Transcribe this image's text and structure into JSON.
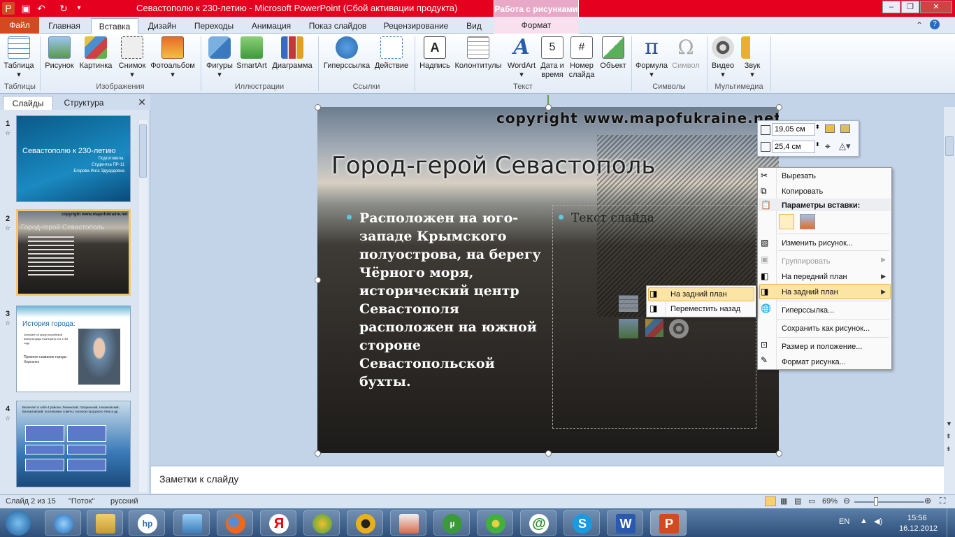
{
  "window": {
    "title": "Севастополю к 230-летию  -  Microsoft PowerPoint (Сбой активации продукта)",
    "context_tab_title": "Работа с рисунками"
  },
  "tabs": [
    "Файл",
    "Главная",
    "Вставка",
    "Дизайн",
    "Переходы",
    "Анимация",
    "Показ слайдов",
    "Рецензирование",
    "Вид",
    "Формат"
  ],
  "ribbon": {
    "groups": [
      "Таблицы",
      "Изображения",
      "Иллюстрации",
      "Ссылки",
      "Текст",
      "Символы",
      "Мультимедиа"
    ],
    "buttons": {
      "table": "Таблица",
      "picture": "Рисунок",
      "clipart": "Картинка",
      "screenshot": "Снимок",
      "photoalbum": "Фотоальбом",
      "shapes": "Фигуры",
      "smartart": "SmartArt",
      "chart": "Диаграмма",
      "hyperlink": "Гиперссылка",
      "action": "Действие",
      "textbox": "Надпись",
      "headerfooter": "Колонтитулы",
      "wordart": "WordArt",
      "datetime_1": "Дата и",
      "datetime_2": "время",
      "slidenum_1": "Номер",
      "slidenum_2": "слайда",
      "object": "Объект",
      "equation": "Формула",
      "symbol": "Символ",
      "video": "Видео",
      "audio": "Звук"
    }
  },
  "panel": {
    "tab_slides": "Слайды",
    "tab_outline": "Структура",
    "close": "✕",
    "thumbs": [
      {
        "num": "1",
        "title": "Севастополю к 230-летию",
        "sub1": "Подготовила:",
        "sub2": "Студентка ПР-11",
        "sub3": "Егорова Инга Эдуардовна"
      },
      {
        "num": "2",
        "title": "Город-герой Севастополь",
        "copyright": "copyright www.mapofukraine.net"
      },
      {
        "num": "3",
        "title": "История города:",
        "b1": "Заложен по указу российской императрицы Екатерины II в 1783 году.",
        "b2": "Прежнее название города - Херсонес"
      },
      {
        "num": "4",
        "b1": "Включает в себя 4 района: Ленинский, Гагаринский, Нахимовский, Балаклавский, поселковые советы; поселок городского типа и др."
      }
    ]
  },
  "slide": {
    "copyright": "copyright www.mapofukraine.net",
    "title": "Город-герой Севастополь",
    "body": "Расположен на юго-западе Крымского полуострова, на берегу Чёрного моря, исторический центр Севастополя расположен на южной стороне Севастопольской бухты.",
    "placeholder_text": "Текст слайда"
  },
  "mini_toolbar": {
    "height_value": "19,05 см",
    "width_value": "25,4 см"
  },
  "context_menu": {
    "cut": "Вырезать",
    "copy": "Копировать",
    "paste_options": "Параметры вставки:",
    "change_picture": "Изменить рисунок...",
    "group": "Группировать",
    "bring_front": "На передний план",
    "send_back": "На задний план",
    "hyperlink": "Гиперссылка...",
    "save_as_picture": "Сохранить как рисунок...",
    "size_position": "Размер и положение...",
    "format_picture": "Формат рисунка..."
  },
  "submenu": {
    "send_to_back": "На задний план",
    "send_backward": "Переместить назад"
  },
  "notes": {
    "placeholder": "Заметки к слайду"
  },
  "status": {
    "slide_of": "Слайд 2 из 15",
    "theme": "\"Поток\"",
    "language": "русский",
    "zoom": "69%"
  },
  "taskbar": {
    "lang": "EN",
    "time": "15:56",
    "date": "16.12.2012"
  },
  "colors": {
    "titlebar": "#e5001f",
    "context_tab": "#e8a8c8",
    "accent_bullet": "#5ec8e0",
    "menu_highlight": "#fbe4a4"
  }
}
